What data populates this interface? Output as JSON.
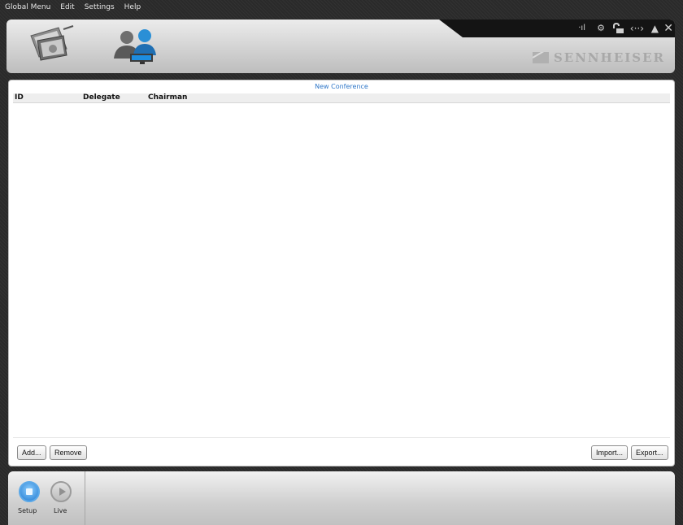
{
  "menu": [
    "Global Menu",
    "Edit",
    "Settings",
    "Help"
  ],
  "header": {
    "logo_text": "SENNHEISER",
    "status_icons": [
      "signal-icon",
      "wrench-icon",
      "lock-icon",
      "connection-icon",
      "warning-icon",
      "close-icon"
    ]
  },
  "panel": {
    "title": "New Conference",
    "columns": [
      "ID",
      "Delegate",
      "Chairman"
    ],
    "buttons": {
      "add": "Add...",
      "remove": "Remove",
      "import": "Import...",
      "export": "Export..."
    }
  },
  "footer": {
    "setup_label": "Setup",
    "live_label": "Live"
  },
  "colors": {
    "accent_blue": "#2f77c8",
    "setup_blue": "#1e78d0"
  }
}
